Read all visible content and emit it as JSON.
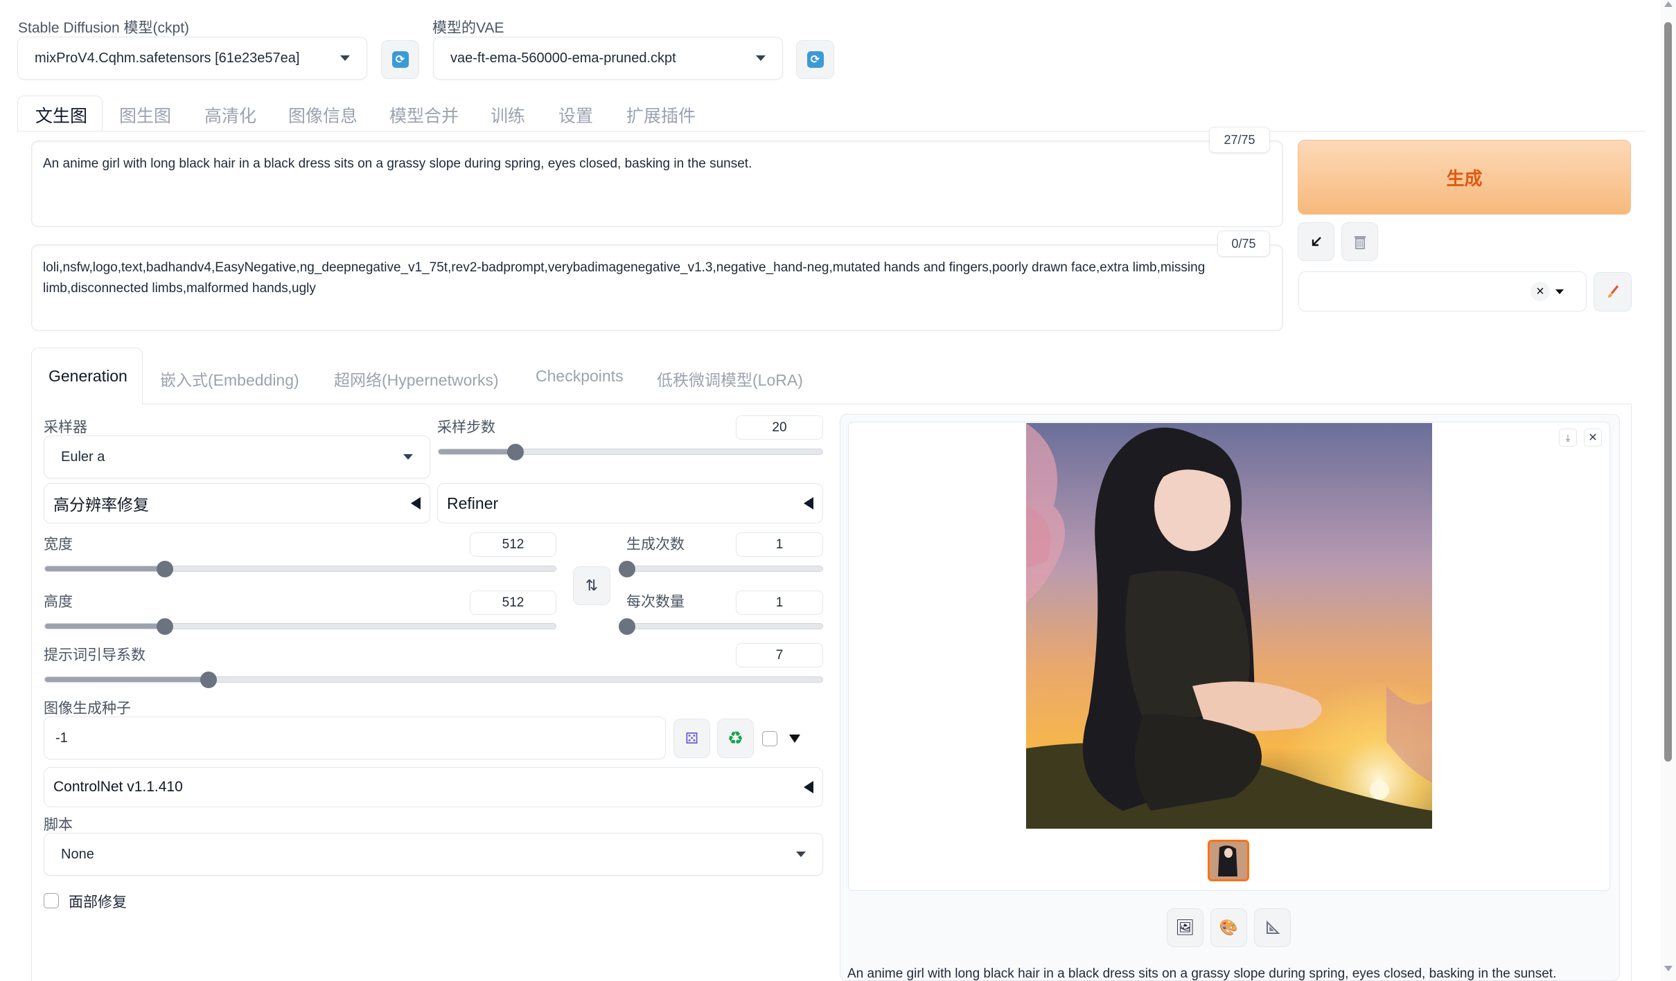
{
  "model": {
    "label": "Stable Diffusion 模型(ckpt)",
    "value": "mixProV4.Cqhm.safetensors [61e23e57ea]"
  },
  "vae": {
    "label": "模型的VAE",
    "value": "vae-ft-ema-560000-ema-pruned.ckpt"
  },
  "main_tabs": [
    "文生图",
    "图生图",
    "高清化",
    "图像信息",
    "模型合并",
    "训练",
    "设置",
    "扩展插件"
  ],
  "prompt": {
    "counter": "27/75",
    "text": "An anime girl with long black hair in a black dress sits on a grassy slope during spring, eyes closed, basking in the sunset."
  },
  "negative_prompt": {
    "counter": "0/75",
    "text": "loli,nsfw,logo,text,badhandv4,EasyNegative,ng_deepnegative_v1_75t,rev2-badprompt,verybadimagenegative_v1.3,negative_hand-neg,mutated hands and fingers,poorly drawn face,extra limb,missing limb,disconnected limbs,malformed hands,ugly"
  },
  "generate_label": "生成",
  "sub_tabs": [
    "Generation",
    "嵌入式(Embedding)",
    "超网络(Hypernetworks)",
    "Checkpoints",
    "低秩微调模型(LoRA)"
  ],
  "sampler": {
    "label": "采样器",
    "value": "Euler a"
  },
  "steps": {
    "label": "采样步数",
    "value": "20",
    "fraction": 0.2
  },
  "hires_label": "高分辨率修复",
  "refiner_label": "Refiner",
  "width": {
    "label": "宽度",
    "value": "512",
    "fraction": 0.235
  },
  "height": {
    "label": "高度",
    "value": "512",
    "fraction": 0.235
  },
  "batch_count": {
    "label": "生成次数",
    "value": "1",
    "fraction": 0.0
  },
  "batch_size": {
    "label": "每次数量",
    "value": "1",
    "fraction": 0.0
  },
  "cfg": {
    "label": "提示词引导系数",
    "value": "7",
    "fraction": 0.21
  },
  "seed": {
    "label": "图像生成种子",
    "value": "-1"
  },
  "controlnet_label": "ControlNet v1.1.410",
  "script": {
    "label": "脚本",
    "value": "None"
  },
  "face_restore_label": "面部修复",
  "output_caption": "An anime girl with long black hair in a black dress sits on a grassy slope during spring, eyes closed, basking in the sunset.",
  "colors": {
    "generate_bg_start": "#fdd5b1",
    "generate_bg_end": "#f6b978",
    "generate_text": "#e05a14",
    "accent_blue": "#3b9bd6"
  }
}
